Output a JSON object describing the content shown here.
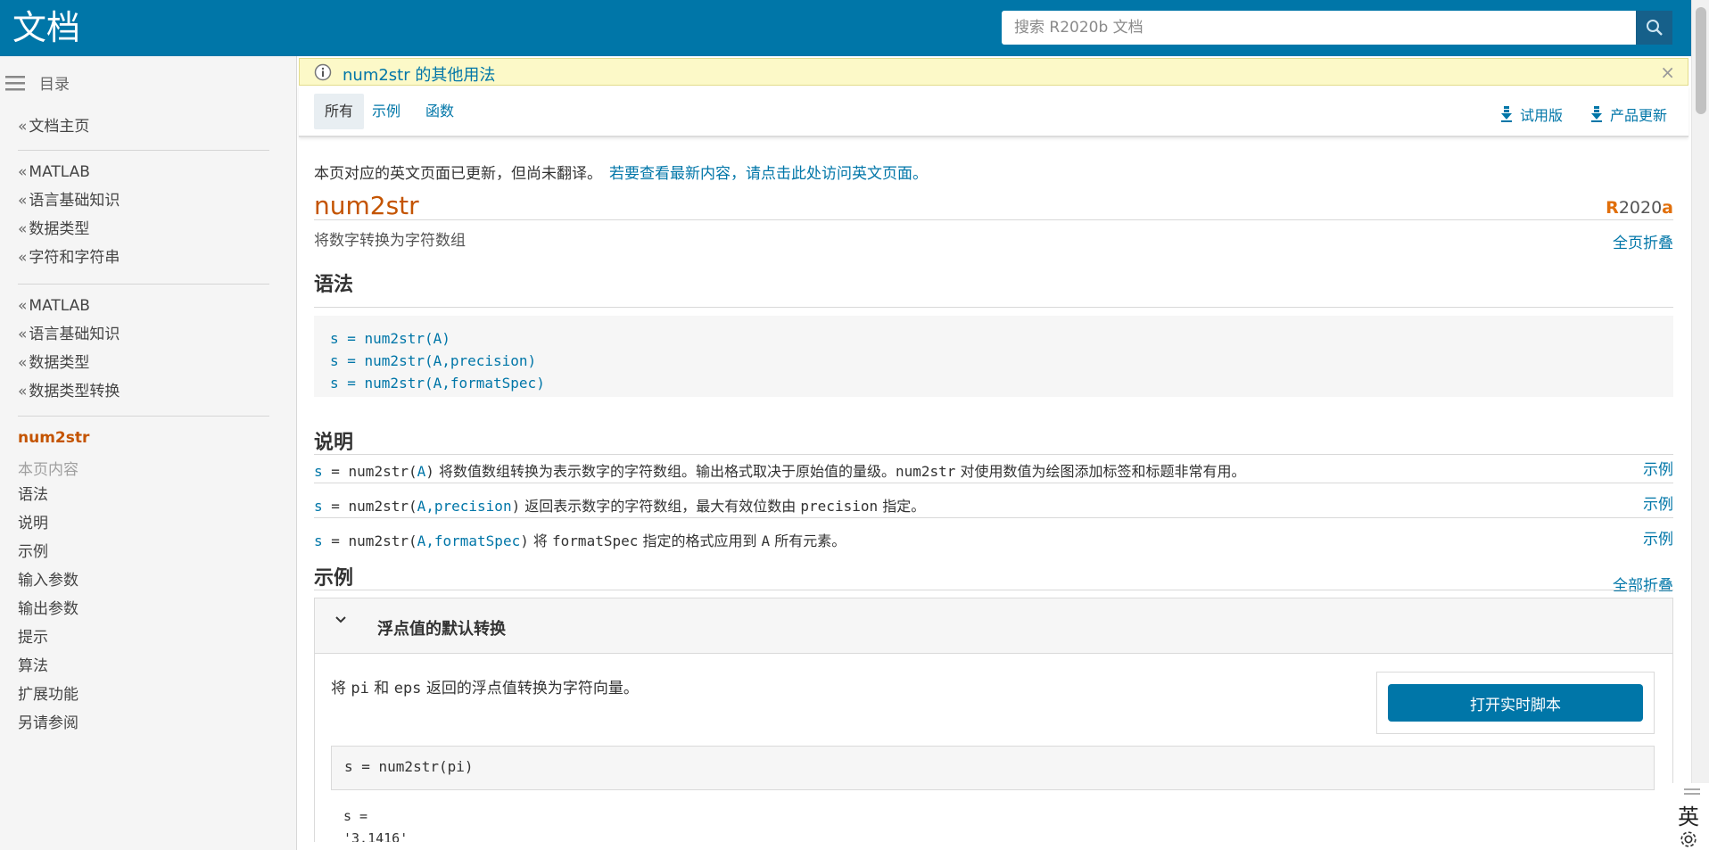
{
  "header": {
    "brand": "文档",
    "search_placeholder": "搜索 R2020b 文档"
  },
  "sidebar": {
    "toc_label": "目录",
    "groups": [
      [
        "文档主页"
      ],
      [
        "MATLAB",
        "语言基础知识",
        "数据类型",
        "字符和字符串"
      ],
      [
        "MATLAB",
        "语言基础知识",
        "数据类型",
        "数据类型转换"
      ]
    ],
    "current_page": "num2str",
    "on_this_page": "本页内容",
    "sections": [
      "语法",
      "说明",
      "示例",
      "输入参数",
      "输出参数",
      "提示",
      "算法",
      "扩展功能",
      "另请参阅"
    ]
  },
  "notice": {
    "text": "num2str 的其他用法",
    "close": "×"
  },
  "tabs": {
    "items": [
      "所有",
      "示例",
      "函数"
    ],
    "active_index": 0,
    "trial": "试用版",
    "updates": "产品更新"
  },
  "content": {
    "untranslated": "本页对应的英文页面已更新，但尚未翻译。",
    "untranslated_link": "若要查看最新内容，请点击此处访问英文页面。",
    "title": "num2str",
    "release_r": "R",
    "release_num": "2020",
    "release_a": "a",
    "purpose": "将数字转换为字符数组",
    "collapse_page": "全页折叠",
    "syntax_heading": "语法",
    "syntax_lines": [
      "s = num2str(A)",
      "s = num2str(A,precision)",
      "s = num2str(A,formatSpec)"
    ],
    "desc_heading": "说明",
    "desc_rows": [
      {
        "s": "s",
        "eq": " = num2str(",
        "args": "A",
        "close": ")",
        "text": " 将数值数组转换为表示数字的字符数组。输出格式取决于原始值的量级。",
        "code": "num2str",
        "text2": " 对使用数值为绘图添加标签和标题非常有用。",
        "example": "示例"
      },
      {
        "s": "s",
        "eq": " = num2str(",
        "args": "A,",
        "args2": "precision",
        "close": ")",
        "text": " 返回表示数字的字符数组，最大有效位数由 ",
        "code": "precision",
        "text2": " 指定。",
        "example": "示例"
      },
      {
        "s": "s",
        "eq": " = num2str(",
        "args": "A,",
        "args2": "formatSpec",
        "close": ")",
        "text": " 将 ",
        "code": "formatSpec",
        "text2": " 指定的格式应用到 ",
        "code2": "A",
        "text3": " 所有元素。",
        "example": "示例"
      }
    ],
    "examples_heading": "示例",
    "collapse_all": "全部折叠",
    "example": {
      "title": "浮点值的默认转换",
      "desc_pre": "将 ",
      "desc_c1": "pi",
      "desc_mid": " 和 ",
      "desc_c2": "eps",
      "desc_post": " 返回的浮点值转换为字符向量。",
      "live_script": "打开实时脚本",
      "code": "s = num2str(pi)",
      "output_lines": [
        "s =",
        "'3.1416'"
      ]
    }
  },
  "ime": {
    "label": "英"
  },
  "colors": {
    "brand_blue": "#0076a8",
    "accent_orange": "#c45400",
    "notice_bg": "#fcf9c8"
  }
}
